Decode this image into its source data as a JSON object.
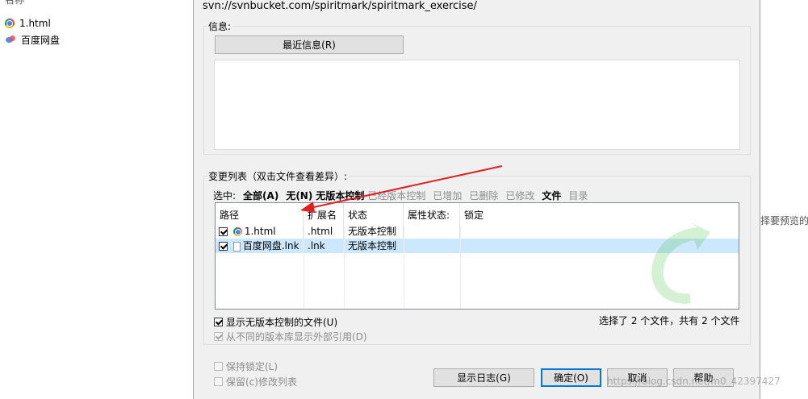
{
  "explorer": {
    "column_header": "名称",
    "files": [
      {
        "name": "1.html",
        "icon": "chrome-icon"
      },
      {
        "name": "百度网盘",
        "icon": "baidu-netdisk-icon"
      }
    ]
  },
  "dialog": {
    "url": "svn://svnbucket.com/spiritmark/spiritmark_exercise/",
    "info_group_title": "信息:",
    "recent_info_button": "最近信息(R)",
    "changes_group_title": "变更列表（双击文件查看差异）:",
    "filter": {
      "label": "选中:",
      "items": [
        {
          "label": "全部(A)",
          "style": "bold"
        },
        {
          "label": "无(N)",
          "style": "bold"
        },
        {
          "label": "无版本控制",
          "style": "bold"
        },
        {
          "label": "已经版本控制",
          "style": "grey"
        },
        {
          "label": "已增加",
          "style": "grey"
        },
        {
          "label": "已删除",
          "style": "grey"
        },
        {
          "label": "已修改",
          "style": "grey"
        },
        {
          "label": "文件",
          "style": "bold"
        },
        {
          "label": "目录",
          "style": "grey"
        }
      ]
    },
    "list": {
      "columns": [
        "路径",
        "扩展名",
        "状态",
        "属性状态:",
        "锁定"
      ],
      "rows": [
        {
          "checked": true,
          "icon": "chrome-icon",
          "path": "1.html",
          "ext": ".html",
          "status": "无版本控制",
          "prop_status": "",
          "lock": "",
          "selected": false
        },
        {
          "checked": true,
          "icon": "file-icon",
          "path": "百度网盘.lnk",
          "ext": ".lnk",
          "status": "无版本控制",
          "prop_status": "",
          "lock": "",
          "selected": true
        }
      ]
    },
    "show_unversioned": {
      "label": "显示无版本控制的文件(U)",
      "checked": true
    },
    "show_externals": {
      "label": "从不同的版本库显示外部引用(D)",
      "checked": true,
      "disabled": true
    },
    "selection_summary": "选择了 2 个文件，共有 2 个文件",
    "keep_locks": {
      "label": "保持锁定(L)",
      "checked": false,
      "disabled": true
    },
    "keep_changelists": {
      "label": "保留(c)修改列表",
      "checked": false,
      "disabled": true
    },
    "buttons": {
      "show_log": "显示日志(G)",
      "ok": "确定(O)",
      "cancel": "取消",
      "help": "帮助"
    }
  },
  "right_pane": {
    "text": "择要预览的"
  },
  "watermark": "https://blog.csdn.net/m0_42397427",
  "colors": {
    "dialog_bg": "#f0f0f0",
    "selection": "#cce8ff",
    "arrow": "#e02020"
  }
}
